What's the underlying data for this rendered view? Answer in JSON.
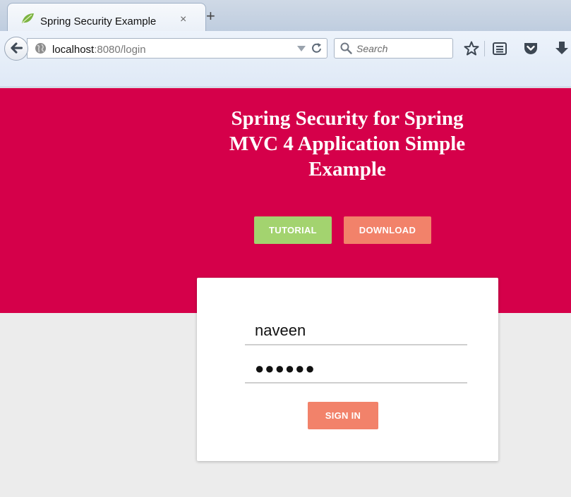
{
  "browser": {
    "tab": {
      "title": "Spring Security Example",
      "close_glyph": "×"
    },
    "new_tab_glyph": "+",
    "url": {
      "host": "localhost",
      "rest": ":8080/login"
    },
    "search": {
      "placeholder": "Search"
    },
    "icons": [
      "back-arrow-icon",
      "globe-icon",
      "dropdown-icon",
      "reload-icon",
      "search-icon",
      "star-icon",
      "reading-list-icon",
      "pocket-icon",
      "download-icon"
    ]
  },
  "hero": {
    "title": "Spring Security for Spring MVC 4 Application Simple Example",
    "tutorial_label": "TUTORIAL",
    "download_label": "DOWNLOAD"
  },
  "login": {
    "username": "naveen",
    "password": "●●●●●●",
    "signin_label": "SIGN IN"
  },
  "colors": {
    "hero": "#d5004a",
    "tutorial": "#a3d36f",
    "accent": "#f2826a",
    "page_bg": "#ececec"
  }
}
